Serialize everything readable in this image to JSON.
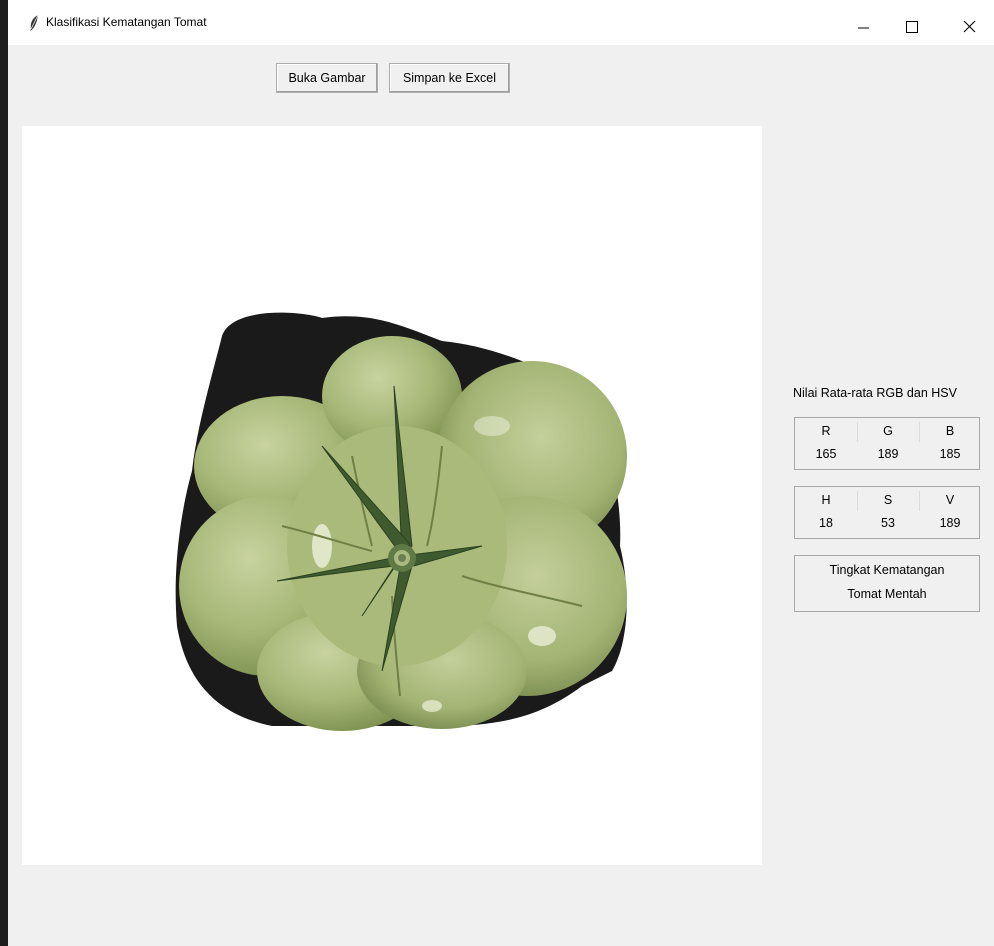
{
  "window": {
    "title": "Klasifikasi Kematangan Tomat",
    "icon": "feather-icon",
    "controls": [
      "minimize-icon",
      "maximize-icon",
      "close-icon"
    ]
  },
  "toolbar": {
    "open_label": "Buka Gambar",
    "save_label": "Simpan ke Excel"
  },
  "image": {
    "subject": "green-tomato-photo"
  },
  "stats": {
    "title": "Nilai Rata-rata RGB dan HSV",
    "rgb": {
      "headers": [
        "R",
        "G",
        "B"
      ],
      "values": [
        "165",
        "189",
        "185"
      ]
    },
    "hsv": {
      "headers": [
        "H",
        "S",
        "V"
      ],
      "values": [
        "18",
        "53",
        "189"
      ]
    }
  },
  "result": {
    "label": "Tingkat Kematangan",
    "value": "Tomat Mentah"
  }
}
